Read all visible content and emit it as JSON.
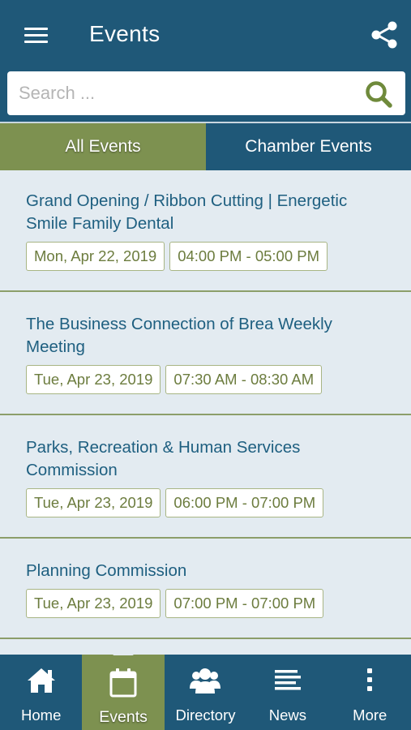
{
  "header": {
    "title": "Events"
  },
  "search": {
    "placeholder": "Search ..."
  },
  "tabs": [
    {
      "label": "All Events",
      "active": true
    },
    {
      "label": "Chamber Events",
      "active": false
    }
  ],
  "events": [
    {
      "title": "Grand Opening / Ribbon Cutting | Energetic Smile Family Dental",
      "date": "Mon, Apr 22, 2019",
      "time": "04:00 PM - 05:00 PM"
    },
    {
      "title": "The Business Connection of Brea Weekly Meeting",
      "date": "Tue, Apr 23, 2019",
      "time": "07:30 AM - 08:30 AM"
    },
    {
      "title": "Parks, Recreation & Human Services Commission",
      "date": "Tue, Apr 23, 2019",
      "time": "06:00 PM - 07:00 PM"
    },
    {
      "title": "Planning Commission",
      "date": "Tue, Apr 23, 2019",
      "time": "07:00 PM - 07:00 PM"
    }
  ],
  "nav": [
    {
      "label": "Home",
      "icon": "home-icon"
    },
    {
      "label": "Events",
      "icon": "calendar-icon",
      "active": true
    },
    {
      "label": "Directory",
      "icon": "people-icon"
    },
    {
      "label": "News",
      "icon": "news-lines-icon"
    },
    {
      "label": "More",
      "icon": "more-vertical-icon"
    }
  ],
  "colors": {
    "primary": "#1f5878",
    "accent": "#7d9150",
    "background": "#e3ebf1",
    "title_text": "#1e5f80",
    "chip_text": "#6c7c3e"
  }
}
